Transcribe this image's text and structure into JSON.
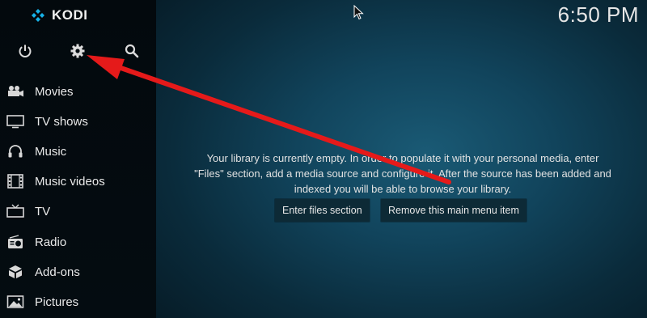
{
  "app": {
    "name": "KODI"
  },
  "clock": "6:50 PM",
  "top_icons": [
    "power-icon",
    "gear-icon",
    "search-icon"
  ],
  "menu": [
    {
      "label": "Movies",
      "icon": "movie-camera-icon"
    },
    {
      "label": "TV shows",
      "icon": "tv-icon"
    },
    {
      "label": "Music",
      "icon": "headphones-icon"
    },
    {
      "label": "Music videos",
      "icon": "film-strip-icon"
    },
    {
      "label": "TV",
      "icon": "tv-antenna-icon"
    },
    {
      "label": "Radio",
      "icon": "radio-icon"
    },
    {
      "label": "Add-ons",
      "icon": "addons-box-icon"
    },
    {
      "label": "Pictures",
      "icon": "picture-icon"
    }
  ],
  "main": {
    "message_line1": "Your library is currently empty. In order to populate it with your personal media, enter",
    "message_line2": "\"Files\" section, add a media source and configure it. After the source has been added and",
    "message_line3": "indexed you will be able to browse your library.",
    "btn_enter_files": "Enter files section",
    "btn_remove_item": "Remove this main menu item"
  },
  "colors": {
    "annotation_arrow": "#e51a1a",
    "accent": "#12b2e7"
  }
}
